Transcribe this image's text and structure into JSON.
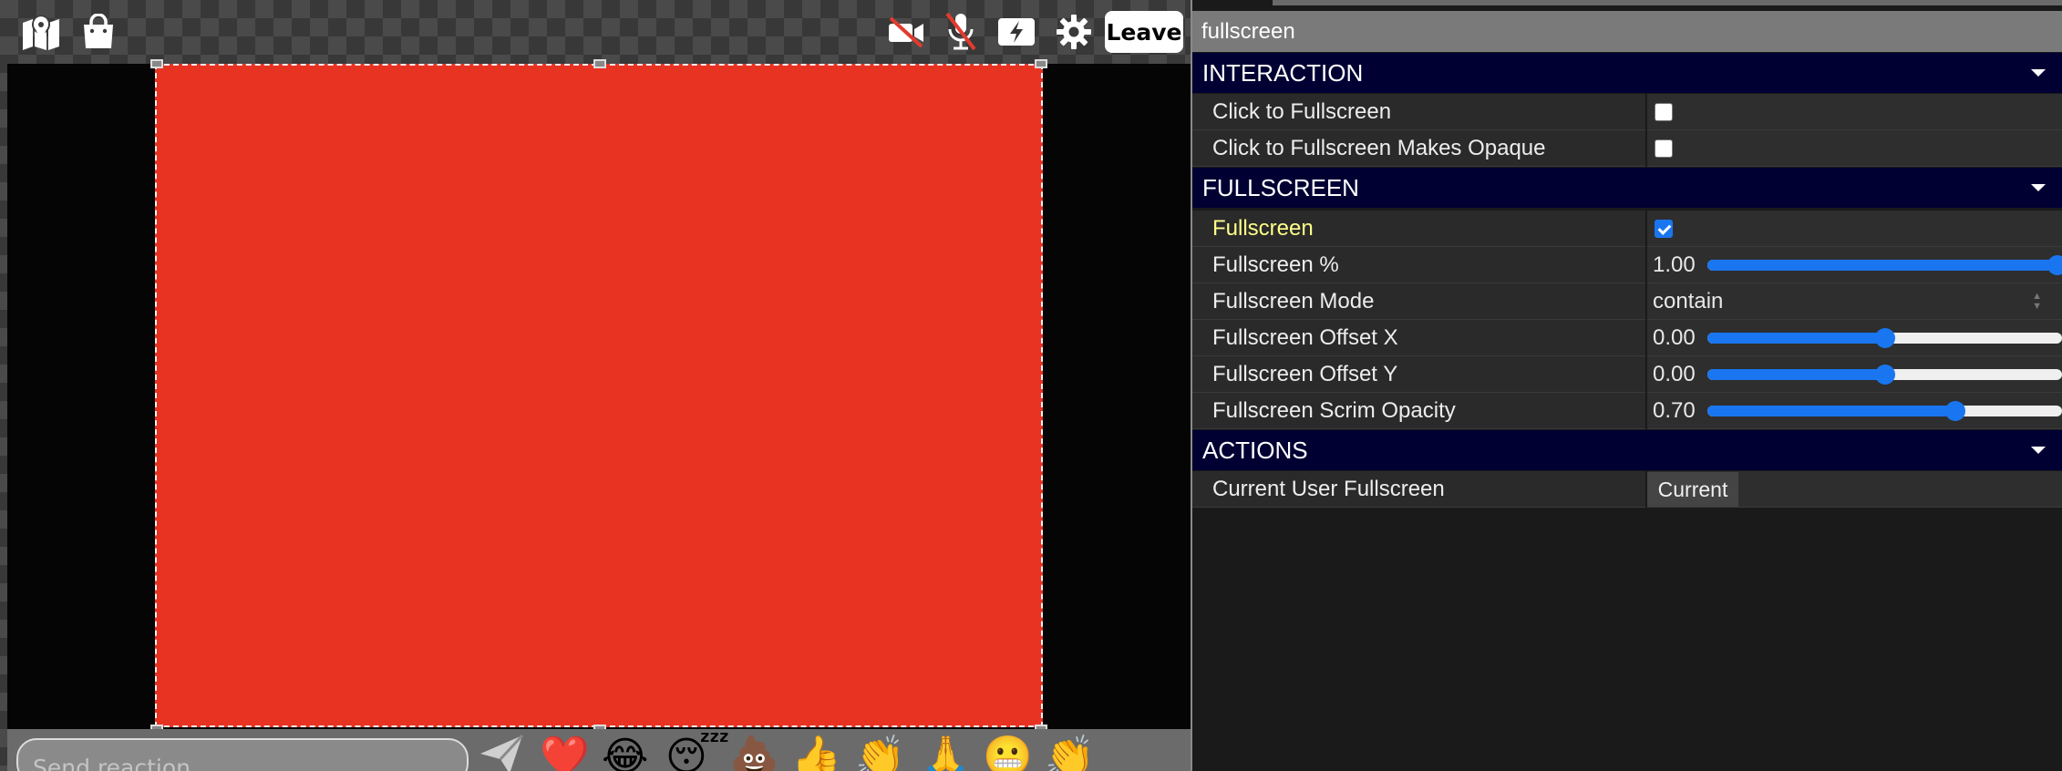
{
  "toolbar": {
    "left_icons": [
      "map-icon",
      "shopping-bag-icon"
    ],
    "right_icons": [
      "camera-off-icon",
      "microphone-off-icon",
      "lightning-icon",
      "gear-icon"
    ],
    "leave_label": "Leave"
  },
  "stage": {
    "frame_color": "#e83222"
  },
  "reactions": {
    "placeholder": "Send reaction...",
    "emojis": [
      "❤️",
      "😂",
      "😴",
      "💩",
      "👍",
      "👏",
      "🙏",
      "😬",
      "👏"
    ]
  },
  "panel": {
    "title": "fullscreen",
    "sections": {
      "interaction": {
        "title": "INTERACTION",
        "rows": [
          {
            "label": "Click to Fullscreen",
            "checked": false
          },
          {
            "label": "Click to Fullscreen Makes Opaque",
            "checked": false
          }
        ]
      },
      "fullscreen": {
        "title": "FULLSCREEN",
        "fullscreen": {
          "label": "Fullscreen",
          "checked": true
        },
        "percent": {
          "label": "Fullscreen %",
          "value": "1.00",
          "level": 1.0
        },
        "mode": {
          "label": "Fullscreen Mode",
          "value": "contain"
        },
        "offset_x": {
          "label": "Fullscreen Offset X",
          "value": "0.00",
          "level": 0.5
        },
        "offset_y": {
          "label": "Fullscreen Offset Y",
          "value": "0.00",
          "level": 0.5
        },
        "scrim": {
          "label": "Fullscreen Scrim Opacity",
          "value": "0.70",
          "level": 0.7
        }
      },
      "actions": {
        "title": "ACTIONS",
        "current_user": {
          "label": "Current User Fullscreen",
          "button": "Current"
        }
      }
    }
  },
  "colors": {
    "accent": "#1976f0",
    "section_bg": "#000033",
    "highlight_label": "#ffff88"
  }
}
